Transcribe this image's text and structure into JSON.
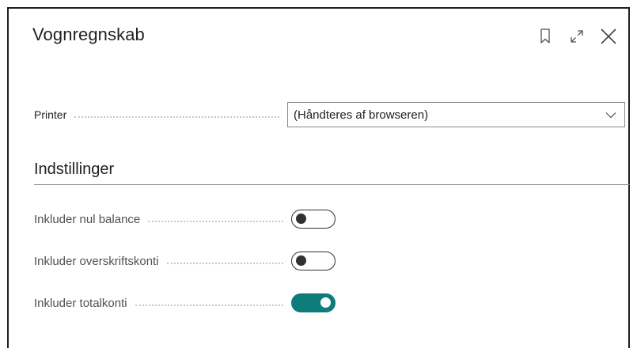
{
  "dialog": {
    "title": "Vognregnskab",
    "actions": [
      {
        "icon": "bookmark-icon"
      },
      {
        "icon": "expand-icon"
      },
      {
        "icon": "close-icon"
      }
    ]
  },
  "printer": {
    "label": "Printer",
    "value": "(Håndteres af browseren)",
    "dropdown_icon": "chevron-down-icon"
  },
  "settings": {
    "title": "Indstillinger",
    "toggles": [
      {
        "label": "Inkluder nul balance",
        "on": false
      },
      {
        "label": "Inkluder overskriftskonti",
        "on": false
      },
      {
        "label": "Inkluder totalkonti",
        "on": true
      }
    ]
  },
  "colors": {
    "toggle_on": "#0e7c7b",
    "toggle_off_border": "#323130"
  }
}
